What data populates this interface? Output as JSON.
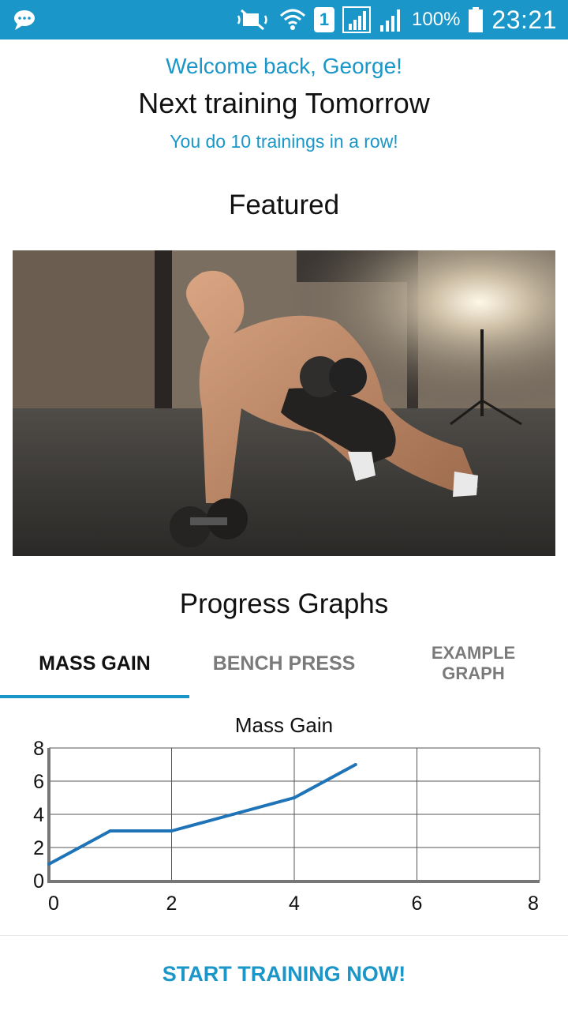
{
  "status_bar": {
    "battery_percent": "100%",
    "time": "23:21",
    "sim_slot": "1",
    "icons": [
      "message-icon",
      "mute-icon",
      "wifi-icon",
      "sim-icon",
      "signal-icon",
      "signal-icon-2",
      "battery-icon"
    ]
  },
  "header": {
    "welcome": "Welcome back, George!",
    "next_training": "Next training Tomorrow",
    "streak": "You do 10 trainings in a row!"
  },
  "featured": {
    "title": "Featured"
  },
  "progress": {
    "title": "Progress Graphs",
    "tabs": [
      {
        "label": "MASS GAIN",
        "active": true
      },
      {
        "label": "BENCH PRESS",
        "active": false
      },
      {
        "label": "EXAMPLE\nGRAPH",
        "active": false
      }
    ]
  },
  "chart_data": {
    "type": "line",
    "title": "Mass Gain",
    "xlabel": "",
    "ylabel": "",
    "xlim": [
      0,
      8
    ],
    "ylim": [
      0,
      8
    ],
    "x_ticks": [
      "0",
      "2",
      "4",
      "6",
      "8"
    ],
    "y_ticks": [
      "0",
      "2",
      "4",
      "6",
      "8"
    ],
    "grid": true,
    "line_color": "#1f73b7",
    "series": [
      {
        "x": [
          0,
          1,
          2,
          3,
          4,
          5
        ],
        "y": [
          1,
          3,
          3,
          4,
          5,
          7
        ]
      }
    ]
  },
  "actions": {
    "start_training": "START TRAINING NOW!"
  },
  "colors": {
    "accent": "#1a96c8",
    "status_bar": "#1a96c8",
    "text_primary": "#111111",
    "tab_inactive": "#7a7a7a"
  }
}
